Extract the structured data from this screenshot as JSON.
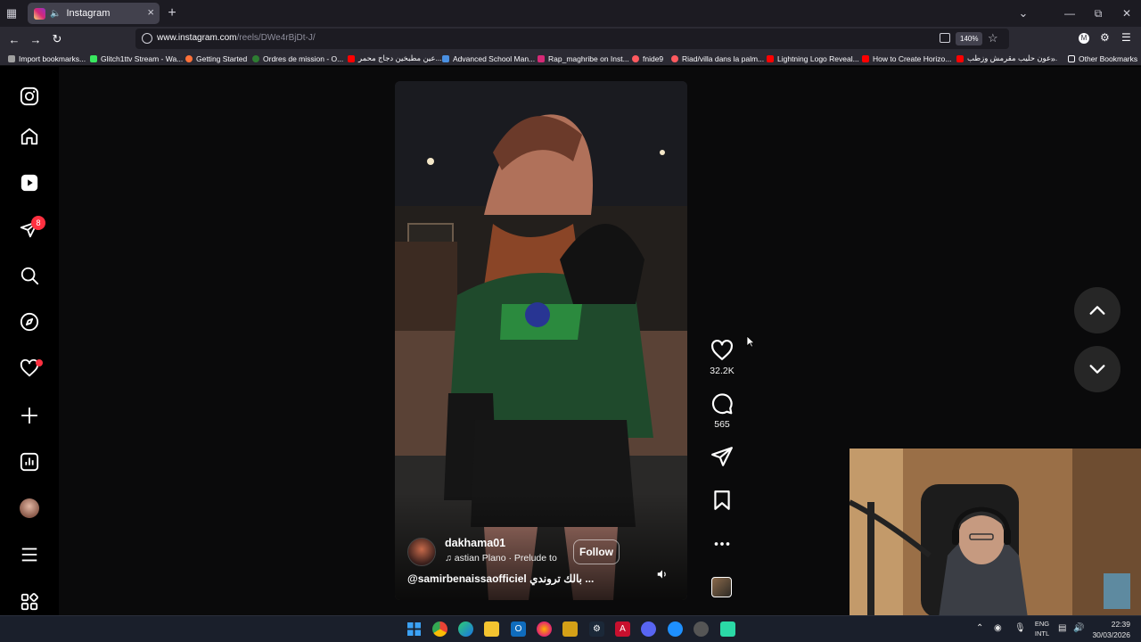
{
  "browser": {
    "tab_title": "Instagram",
    "url_domain": "www.instagram.com",
    "url_path": "/reels/DWe4rBjDt-J/",
    "zoom": "140%",
    "bookmarks": [
      {
        "label": "Import bookmarks...",
        "color": "#a0a0a0"
      },
      {
        "label": "Glitch1ttv Stream - Wa...",
        "color": "#39e75f"
      },
      {
        "label": "Getting Started",
        "color": "#ff7139"
      },
      {
        "label": "Ordres de mission - O...",
        "color": "#2e7d32"
      },
      {
        "label": "عين مطبخين دجاج محمر...",
        "color": "#ff0000"
      },
      {
        "label": "Advanced School Man...",
        "color": "#4a90e2"
      },
      {
        "label": "Rap_maghribe on Inst...",
        "color": "#d62976"
      },
      {
        "label": "fnide9",
        "color": "#ff5a5f"
      },
      {
        "label": "Riad/villa dans la palm...",
        "color": "#ff5a5f"
      },
      {
        "label": "Lightning Logo Reveal...",
        "color": "#ff0000"
      },
      {
        "label": "How to Create Horizo...",
        "color": "#ff0000"
      },
      {
        "label": "عون حليب مقرمش وزطب...",
        "color": "#ff0000"
      }
    ],
    "other_bookmarks": "Other Bookmarks"
  },
  "instagram": {
    "sidebar": {
      "messages_badge": "8"
    },
    "reel": {
      "username": "dakhama01",
      "audio": "astian Plano · Prelude to",
      "follow_label": "Follow",
      "caption": "@samirbenaissaofficiel بالك تروندي ..."
    },
    "actions": {
      "likes": "32.2K",
      "comments": "565"
    }
  },
  "taskbar": {
    "lang_top": "ENG",
    "lang_bottom": "INTL",
    "time": "22:39",
    "date": "30/03/2026"
  }
}
